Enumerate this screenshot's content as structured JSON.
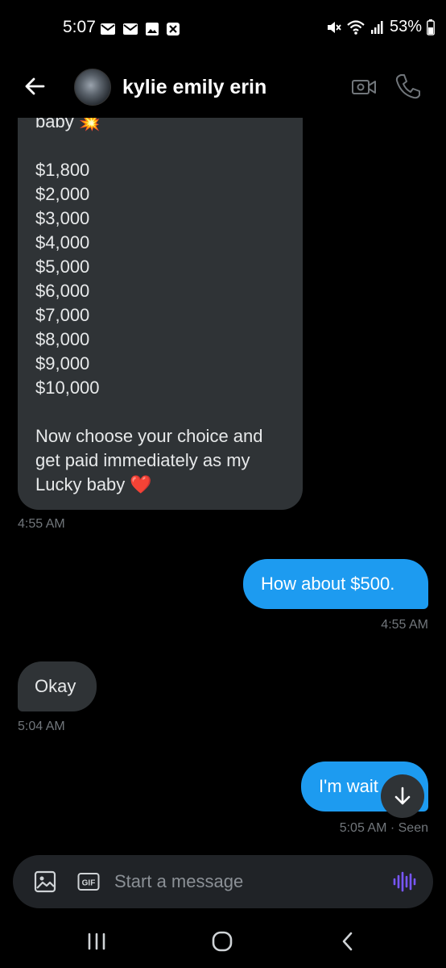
{
  "status_bar": {
    "time": "5:07",
    "battery": "53%"
  },
  "header": {
    "contact_name": "kylie emily erin"
  },
  "messages": {
    "m1": {
      "text": "baby 💥\n\n$1,800\n$2,000\n$3,000\n$4,000\n$5,000\n$6,000\n$7,000\n$8,000\n$9,000\n$10,000\n\nNow choose your choice and\nget paid immediately as my\nLucky baby ❤️",
      "timestamp": "4:55 AM"
    },
    "m2": {
      "text": "How about $500.",
      "timestamp": "4:55 AM"
    },
    "m3": {
      "text": "Okay",
      "timestamp": "5:04 AM"
    },
    "m4": {
      "text": "I'm wait",
      "timestamp": "5:05 AM · Seen"
    }
  },
  "composer": {
    "placeholder": "Start a message",
    "gif_label": "GIF"
  },
  "colors": {
    "accent": "#1d9bf0",
    "incoming_bubble": "#2f3336",
    "voice": "#7856ff"
  },
  "icons": {
    "back": "arrow-left-icon",
    "video": "video-camera-icon",
    "call": "phone-icon",
    "media": "image-icon",
    "gif": "gif-icon",
    "voice": "voice-wave-icon",
    "scroll": "arrow-down-icon"
  }
}
